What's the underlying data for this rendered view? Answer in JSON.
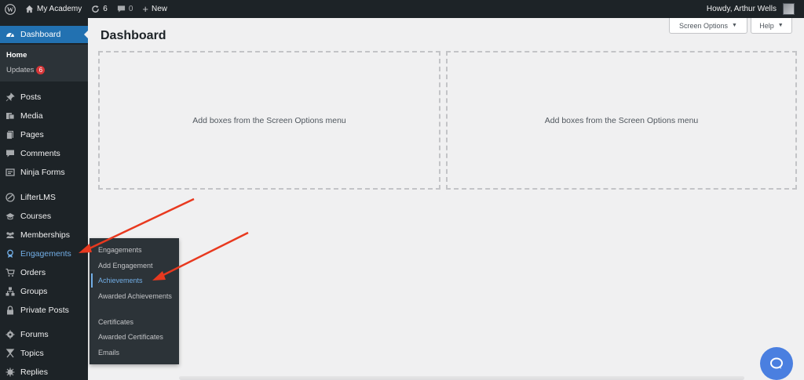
{
  "adminbar": {
    "site_name": "My Academy",
    "updates_count": "6",
    "comments_count": "0",
    "new_label": "New",
    "greeting": "Howdy, Arthur Wells"
  },
  "sidebar": {
    "dashboard_label": "Dashboard",
    "dashboard_sub": {
      "home": "Home",
      "updates": "Updates",
      "updates_badge": "6"
    },
    "items": [
      {
        "label": "Posts",
        "icon": "pin-icon"
      },
      {
        "label": "Media",
        "icon": "media-icon"
      },
      {
        "label": "Pages",
        "icon": "pages-icon"
      },
      {
        "label": "Comments",
        "icon": "comments-icon"
      },
      {
        "label": "Ninja Forms",
        "icon": "forms-icon"
      },
      {
        "label": "LifterLMS",
        "icon": "lifterlms-icon"
      },
      {
        "label": "Courses",
        "icon": "courses-icon"
      },
      {
        "label": "Memberships",
        "icon": "memberships-icon"
      },
      {
        "label": "Engagements",
        "icon": "engagements-icon"
      },
      {
        "label": "Orders",
        "icon": "cart-icon"
      },
      {
        "label": "Groups",
        "icon": "groups-icon"
      },
      {
        "label": "Private Posts",
        "icon": "lock-icon"
      },
      {
        "label": "Forums",
        "icon": "forums-icon"
      },
      {
        "label": "Topics",
        "icon": "topics-icon"
      },
      {
        "label": "Replies",
        "icon": "replies-icon"
      }
    ]
  },
  "flyout": {
    "items": [
      "Engagements",
      "Add Engagement",
      "Achievements",
      "Awarded Achievements",
      "Certificates",
      "Awarded Certificates",
      "Emails"
    ]
  },
  "main": {
    "title": "Dashboard",
    "screen_options_label": "Screen Options",
    "help_label": "Help",
    "box_left_text": "Add boxes from the Screen Options menu",
    "box_right_text": "Add boxes from the Screen Options menu"
  },
  "colors": {
    "adminbar_bg": "#1d2327",
    "accent": "#2271b1",
    "hover_blue": "#72aee6",
    "annotation_arrow": "#e8391f",
    "beacon": "#4a7fe0"
  }
}
